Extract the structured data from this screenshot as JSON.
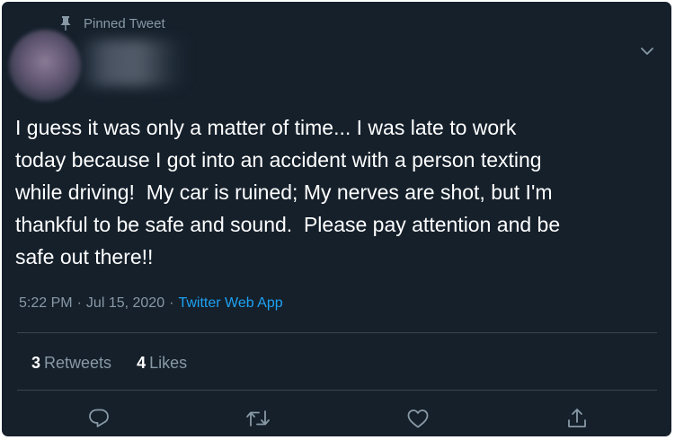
{
  "tweet": {
    "pinned_label": "Pinned Tweet",
    "text": "I guess it was only a matter of time... I was late to work\ntoday because I got into an accident with a person texting\nwhile driving!  My car is ruined; My nerves are shot, but I'm\nthankful to be safe and sound.  Please pay attention and be\nsafe out there!!",
    "time": "5:22 PM",
    "date": "Jul 15, 2020",
    "separator": "·",
    "source_app": "Twitter Web App",
    "retweets_count": "3",
    "retweets_label": "Retweets",
    "likes_count": "4",
    "likes_label": "Likes"
  },
  "icons": {
    "pin": "pin-icon",
    "more": "chevron-down-icon",
    "reply": "reply-icon",
    "retweet": "retweet-icon",
    "like": "heart-icon",
    "share": "share-icon"
  },
  "colors": {
    "background": "#15202b",
    "text": "#ffffff",
    "secondary": "#8899a6",
    "link": "#1da1f2",
    "divider": "#38444d"
  }
}
